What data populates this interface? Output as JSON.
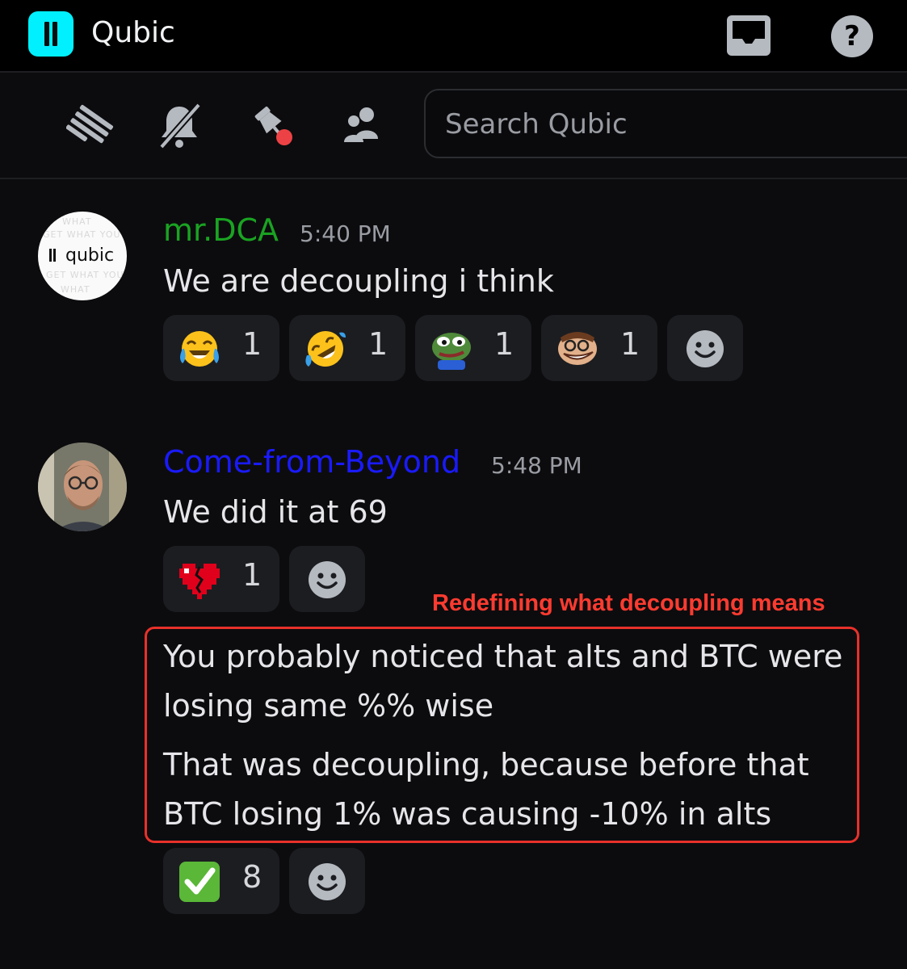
{
  "header": {
    "server_name": "Qubic",
    "server_icon": "qubic-logo-icon",
    "inbox_icon": "inbox-icon",
    "help_icon": "help-icon"
  },
  "toolbar": {
    "icons": [
      "threads-icon",
      "mute-bell-icon",
      "pinned-messages-icon",
      "member-list-icon"
    ],
    "search_placeholder": "Search Qubic"
  },
  "messages": [
    {
      "author": "mr.DCA",
      "author_color": "#1aa322",
      "time": "5:40 PM",
      "avatar": "qubic-avatar",
      "lines": [
        "We are decoupling i think"
      ],
      "reactions": [
        {
          "emoji": "face-with-tears-of-joy",
          "count": "1"
        },
        {
          "emoji": "rolling-on-the-floor-laughing",
          "count": "1"
        },
        {
          "emoji": "pepe-frog",
          "count": "1"
        },
        {
          "emoji": "troll-face",
          "count": "1"
        }
      ]
    },
    {
      "author": "Come-from-Beyond",
      "author_color": "#1a1aff",
      "time": "5:48 PM",
      "avatar": "cfb-avatar",
      "lines": [
        "We did it at 69"
      ],
      "reactions": [
        {
          "emoji": "broken-heart",
          "count": "1"
        }
      ],
      "followups": [
        [
          "You probably noticed that alts and BTC were",
          "losing same %% wise"
        ],
        [
          "That was decoupling, because before that",
          "BTC losing 1% was causing -10% in alts"
        ]
      ],
      "followup_reactions": [
        {
          "emoji": "white-check-mark",
          "count": "8"
        }
      ]
    }
  ],
  "annotation": {
    "label": "Redefining what decoupling means",
    "color": "#ff3b30"
  }
}
